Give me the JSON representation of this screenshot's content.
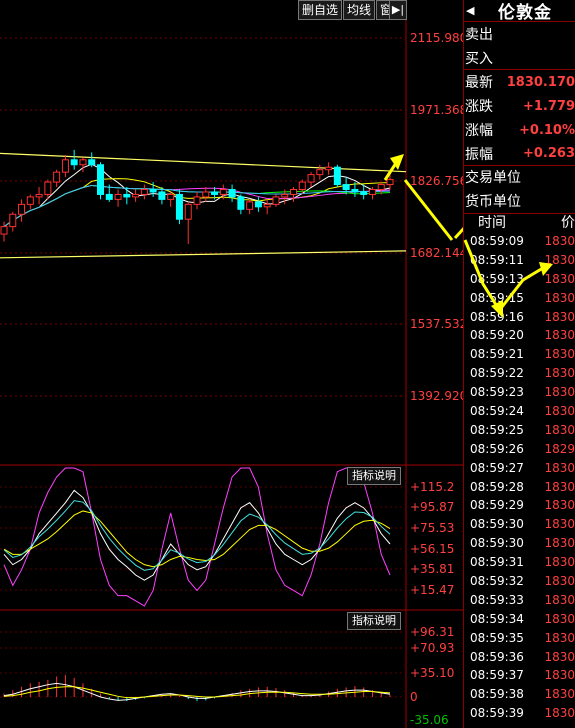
{
  "toolbar": {
    "btn_delete_watch": "删自选",
    "btn_ma": "均线",
    "btn_window": "窗",
    "btn_arrow": "▶|"
  },
  "price_axis": [
    "2115.980",
    "1971.368",
    "1826.756",
    "1682.144",
    "1537.532",
    "1392.920"
  ],
  "indicator1": {
    "button": "指标说明",
    "axis": [
      "+115.2",
      "+95.87",
      "+75.53",
      "+56.15",
      "+35.81",
      "+15.47"
    ]
  },
  "indicator2": {
    "button": "指标说明",
    "axis": [
      "+96.31",
      "+70.93",
      "+35.10",
      "0",
      "-35.06"
    ]
  },
  "quote": {
    "arrow": "◀",
    "name": "伦敦金",
    "sell_label": "卖出",
    "buy_label": "买入",
    "latest_label": "最新",
    "latest_value": "1830.170",
    "change_label": "涨跌",
    "change_value": "+1.779",
    "pct_label": "涨幅",
    "pct_value": "+0.10%",
    "amp_label": "振幅",
    "amp_value": "+0.263",
    "trade_unit": "交易单位",
    "currency_unit": "货币单位"
  },
  "ticks": {
    "time_header": "时间",
    "price_header": "价",
    "rows": [
      [
        "08:59:09",
        "1830"
      ],
      [
        "08:59:11",
        "1830"
      ],
      [
        "08:59:13",
        "1830"
      ],
      [
        "08:59:15",
        "1830"
      ],
      [
        "08:59:16",
        "1830"
      ],
      [
        "08:59:20",
        "1830"
      ],
      [
        "08:59:21",
        "1830"
      ],
      [
        "08:59:22",
        "1830"
      ],
      [
        "08:59:23",
        "1830"
      ],
      [
        "08:59:24",
        "1830"
      ],
      [
        "08:59:25",
        "1830"
      ],
      [
        "08:59:26",
        "1829"
      ],
      [
        "08:59:27",
        "1830"
      ],
      [
        "08:59:28",
        "1830"
      ],
      [
        "08:59:29",
        "1830"
      ],
      [
        "08:59:30",
        "1830"
      ],
      [
        "08:59:30",
        "1830"
      ],
      [
        "08:59:31",
        "1830"
      ],
      [
        "08:59:32",
        "1830"
      ],
      [
        "08:59:33",
        "1830"
      ],
      [
        "08:59:34",
        "1830"
      ],
      [
        "08:59:35",
        "1830"
      ],
      [
        "08:59:36",
        "1830"
      ],
      [
        "08:59:37",
        "1830"
      ],
      [
        "08:59:38",
        "1830"
      ],
      [
        "08:59:39",
        "1830"
      ]
    ]
  },
  "chart_data": {
    "type": "candlestick",
    "price_range": [
      1392.92,
      2115.98
    ],
    "candles": [
      [
        1720,
        1745,
        1705,
        1735
      ],
      [
        1735,
        1765,
        1725,
        1760
      ],
      [
        1760,
        1790,
        1745,
        1780
      ],
      [
        1780,
        1800,
        1770,
        1795
      ],
      [
        1795,
        1815,
        1780,
        1800
      ],
      [
        1800,
        1830,
        1790,
        1825
      ],
      [
        1825,
        1850,
        1815,
        1845
      ],
      [
        1845,
        1880,
        1835,
        1870
      ],
      [
        1870,
        1890,
        1850,
        1860
      ],
      [
        1860,
        1875,
        1845,
        1870
      ],
      [
        1870,
        1885,
        1855,
        1860
      ],
      [
        1860,
        1865,
        1790,
        1800
      ],
      [
        1800,
        1820,
        1785,
        1790
      ],
      [
        1790,
        1810,
        1775,
        1800
      ],
      [
        1800,
        1815,
        1780,
        1795
      ],
      [
        1795,
        1810,
        1785,
        1800
      ],
      [
        1800,
        1820,
        1790,
        1810
      ],
      [
        1810,
        1825,
        1795,
        1805
      ],
      [
        1805,
        1815,
        1780,
        1790
      ],
      [
        1790,
        1805,
        1775,
        1800
      ],
      [
        1800,
        1810,
        1740,
        1750
      ],
      [
        1750,
        1785,
        1700,
        1780
      ],
      [
        1780,
        1805,
        1770,
        1795
      ],
      [
        1795,
        1815,
        1785,
        1805
      ],
      [
        1805,
        1815,
        1790,
        1800
      ],
      [
        1800,
        1820,
        1790,
        1810
      ],
      [
        1810,
        1820,
        1785,
        1795
      ],
      [
        1795,
        1800,
        1760,
        1770
      ],
      [
        1770,
        1790,
        1760,
        1785
      ],
      [
        1785,
        1795,
        1765,
        1775
      ],
      [
        1775,
        1790,
        1760,
        1780
      ],
      [
        1780,
        1800,
        1775,
        1795
      ],
      [
        1795,
        1810,
        1780,
        1800
      ],
      [
        1800,
        1815,
        1785,
        1810
      ],
      [
        1810,
        1830,
        1800,
        1825
      ],
      [
        1825,
        1845,
        1815,
        1840
      ],
      [
        1840,
        1860,
        1830,
        1850
      ],
      [
        1850,
        1865,
        1840,
        1855
      ],
      [
        1855,
        1860,
        1815,
        1820
      ],
      [
        1820,
        1835,
        1800,
        1810
      ],
      [
        1810,
        1825,
        1795,
        1805
      ],
      [
        1805,
        1820,
        1790,
        1800
      ],
      [
        1800,
        1815,
        1790,
        1810
      ],
      [
        1810,
        1825,
        1800,
        1820
      ],
      [
        1820,
        1840,
        1810,
        1830
      ]
    ],
    "resistance_line": [
      [
        0,
        1883
      ],
      [
        44,
        1846
      ]
    ],
    "support_line": [
      [
        0,
        1672
      ],
      [
        44,
        1686
      ]
    ],
    "kdj": {
      "k": [
        50,
        40,
        45,
        55,
        70,
        80,
        90,
        100,
        112,
        105,
        90,
        70,
        55,
        45,
        38,
        30,
        25,
        30,
        45,
        60,
        50,
        40,
        35,
        38,
        50,
        65,
        80,
        95,
        100,
        90,
        75,
        60,
        50,
        45,
        40,
        45,
        55,
        70,
        85,
        95,
        100,
        95,
        85,
        70,
        60
      ],
      "d": [
        55,
        50,
        50,
        55,
        60,
        65,
        72,
        80,
        88,
        92,
        90,
        82,
        72,
        62,
        52,
        45,
        40,
        38,
        40,
        45,
        48,
        47,
        45,
        44,
        45,
        50,
        58,
        66,
        74,
        78,
        78,
        74,
        68,
        62,
        56,
        53,
        53,
        56,
        62,
        70,
        78,
        82,
        83,
        80,
        75
      ],
      "j": [
        40,
        20,
        35,
        55,
        90,
        110,
        125,
        140,
        160,
        130,
        90,
        45,
        20,
        10,
        10,
        5,
        0,
        15,
        55,
        90,
        55,
        25,
        15,
        25,
        60,
        95,
        125,
        150,
        150,
        115,
        70,
        35,
        20,
        15,
        10,
        30,
        60,
        100,
        130,
        145,
        145,
        120,
        90,
        50,
        30
      ]
    },
    "macd_hist": [
      5,
      10,
      15,
      20,
      22,
      25,
      30,
      32,
      28,
      20,
      12,
      5,
      -2,
      -5,
      -6,
      -4,
      -2,
      0,
      3,
      5,
      2,
      -3,
      -6,
      -5,
      -2,
      2,
      6,
      10,
      12,
      14,
      15,
      13,
      10,
      6,
      3,
      2,
      4,
      8,
      12,
      14,
      16,
      14,
      10,
      6,
      3
    ],
    "macd_dif": [
      2,
      4,
      8,
      12,
      15,
      18,
      20,
      18,
      15,
      10,
      5,
      0,
      -3,
      -5,
      -4,
      -2,
      0,
      2,
      4,
      5,
      3,
      0,
      -2,
      -2,
      0,
      2,
      4,
      6,
      8,
      9,
      9,
      8,
      6,
      4,
      2,
      2,
      3,
      5,
      7,
      9,
      10,
      10,
      8,
      6,
      4
    ],
    "macd_dea": [
      1,
      2,
      4,
      7,
      9,
      12,
      14,
      15,
      15,
      13,
      10,
      7,
      4,
      1,
      -1,
      -1,
      0,
      1,
      2,
      3,
      3,
      2,
      1,
      0,
      0,
      1,
      2,
      3,
      5,
      6,
      7,
      7,
      7,
      6,
      5,
      4,
      4,
      4,
      5,
      6,
      7,
      8,
      8,
      7,
      6
    ]
  }
}
